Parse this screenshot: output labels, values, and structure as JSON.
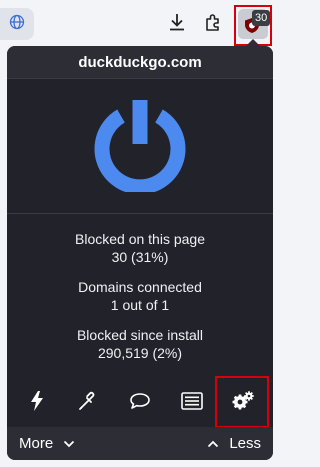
{
  "toolbar": {
    "extension_badge": "30"
  },
  "popup": {
    "site": "duckduckgo.com",
    "stats": [
      {
        "label": "Blocked on this page",
        "value": "30 (31%)"
      },
      {
        "label": "Domains connected",
        "value": "1 out of 1"
      },
      {
        "label": "Blocked since install",
        "value": "290,519 (2%)"
      }
    ],
    "footer": {
      "more_label": "More",
      "less_label": "Less"
    }
  },
  "colors": {
    "power_blue": "#4d8af0",
    "popup_bg": "#22232a",
    "header_bg": "#2c2d35",
    "highlight_red": "#d6000d"
  },
  "icons": {
    "url": "globe-icon",
    "download": "download-icon",
    "extensions": "puzzle-icon",
    "ublock": "ublock-shield-icon",
    "power": "power-icon",
    "zap": "lightning-icon",
    "picker": "eyedropper-icon",
    "report": "chat-bubble-icon",
    "logger": "list-icon",
    "settings": "gears-icon"
  }
}
